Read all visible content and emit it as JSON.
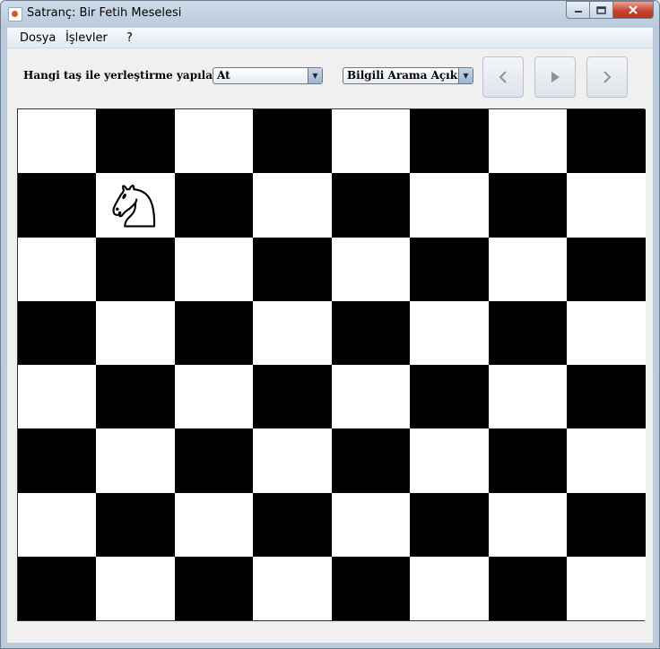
{
  "window": {
    "title": "Satranç: Bir Fetih Meselesi"
  },
  "menu": {
    "items": [
      "Dosya",
      "İşlevler",
      "?"
    ]
  },
  "controls": {
    "piece_question": "Hangi taş ile yerleştirme yapılacak?",
    "piece_select_value": "At",
    "search_select_value": "Bilgili Arama Açık"
  },
  "board": {
    "rows": 8,
    "cols": 8,
    "light_color": "#ffffff",
    "dark_color": "#000000",
    "top_left_light": true,
    "pieces": [
      {
        "type": "knight",
        "icon": "knight-icon",
        "row": 1,
        "col": 1
      }
    ]
  }
}
